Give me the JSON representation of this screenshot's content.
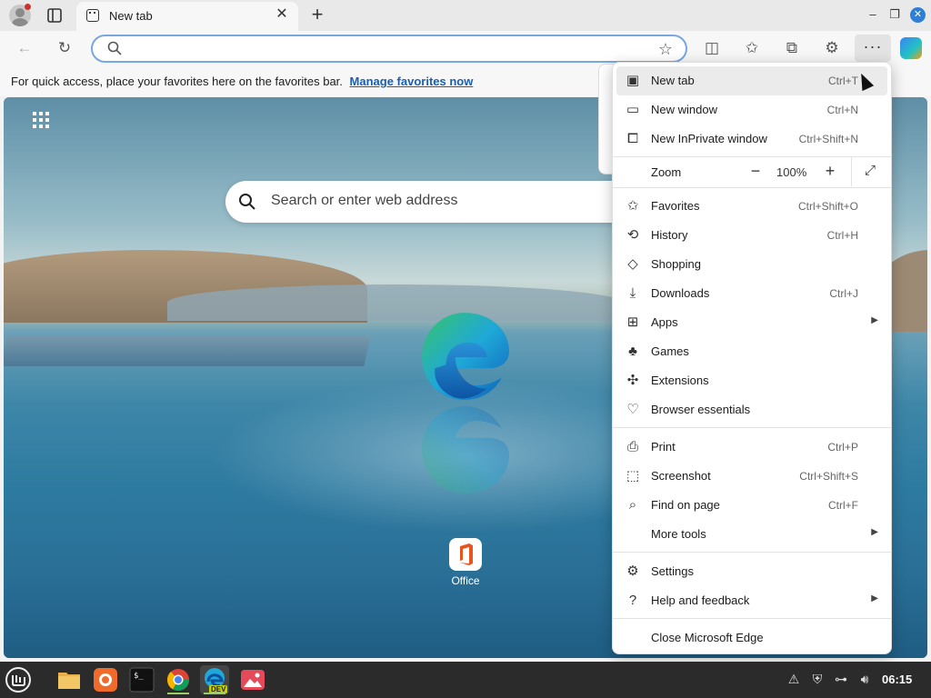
{
  "tab": {
    "title": "New tab"
  },
  "toolbar": {
    "more": "···"
  },
  "favorites_bar": {
    "message": "For quick access, place your favorites here on the favorites bar.",
    "link": "Manage favorites now"
  },
  "newtab_page": {
    "search_placeholder": "Search or enter web address",
    "quick_links": [
      {
        "label": "Office"
      }
    ]
  },
  "menu": {
    "items": [
      {
        "label": "New tab",
        "shortcut": "Ctrl+T",
        "icon": "new-tab-icon"
      },
      {
        "label": "New window",
        "shortcut": "Ctrl+N",
        "icon": "new-window-icon"
      },
      {
        "label": "New InPrivate window",
        "shortcut": "Ctrl+Shift+N",
        "icon": "inprivate-icon"
      }
    ],
    "zoom": {
      "label": "Zoom",
      "value": "100%"
    },
    "group2": [
      {
        "label": "Favorites",
        "shortcut": "Ctrl+Shift+O",
        "icon": "favorites-icon"
      },
      {
        "label": "History",
        "shortcut": "Ctrl+H",
        "icon": "history-icon"
      },
      {
        "label": "Shopping",
        "shortcut": "",
        "icon": "shopping-icon"
      },
      {
        "label": "Downloads",
        "shortcut": "Ctrl+J",
        "icon": "downloads-icon"
      },
      {
        "label": "Apps",
        "shortcut": "",
        "icon": "apps-icon",
        "submenu": true
      },
      {
        "label": "Games",
        "shortcut": "",
        "icon": "games-icon"
      },
      {
        "label": "Extensions",
        "shortcut": "",
        "icon": "extensions-icon"
      },
      {
        "label": "Browser essentials",
        "shortcut": "",
        "icon": "heart-pulse-icon"
      }
    ],
    "group3": [
      {
        "label": "Print",
        "shortcut": "Ctrl+P",
        "icon": "print-icon"
      },
      {
        "label": "Screenshot",
        "shortcut": "Ctrl+Shift+S",
        "icon": "screenshot-icon"
      },
      {
        "label": "Find on page",
        "shortcut": "Ctrl+F",
        "icon": "find-icon"
      },
      {
        "label": "More tools",
        "shortcut": "",
        "icon": "",
        "submenu": true
      }
    ],
    "group4": [
      {
        "label": "Settings",
        "shortcut": "",
        "icon": "settings-icon"
      },
      {
        "label": "Help and feedback",
        "shortcut": "",
        "icon": "help-icon",
        "submenu": true
      }
    ],
    "close": {
      "label": "Close Microsoft Edge"
    }
  },
  "taskbar": {
    "clock": "06:15",
    "edge_badge": "DEV"
  },
  "colors": {
    "accent": "#1a5fb4",
    "address_border": "#79a7e0",
    "taskbar": "#2b2b2b"
  }
}
